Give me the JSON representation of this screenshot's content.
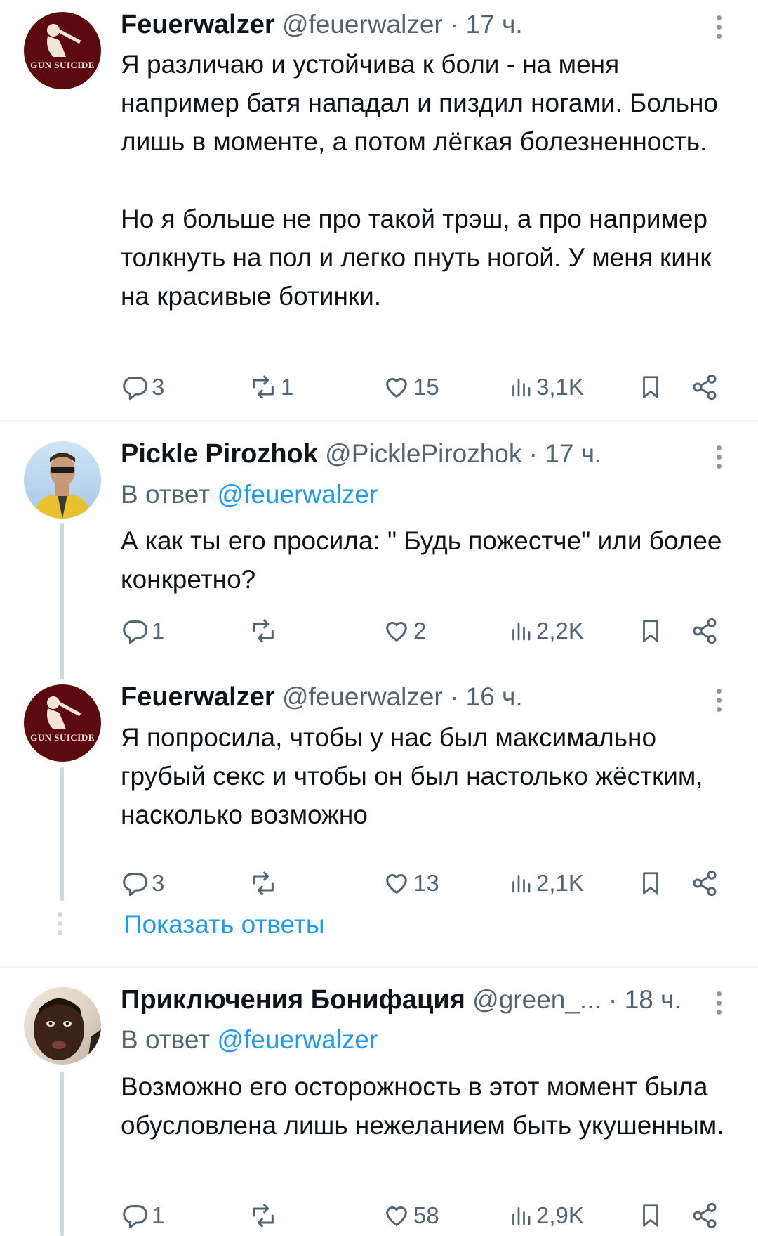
{
  "tweets": [
    {
      "name": "Feuerwalzer",
      "handle": "@feuerwalzer",
      "dot": "·",
      "time": "17 ч.",
      "avatar_icon": "gun-suicide-avatar",
      "avatar_text": "GUN SUICIDE",
      "body": "Я различаю и устойчива к боли  - на меня например батя нападал и пиздил ногами. Больно лишь в моменте, а потом лёгкая болезненность.\n\nНо я больше не про такой трэш, а про например толкнуть на пол и легко пнуть ногой. У меня кинк на красивые ботинки.",
      "replies": "3",
      "retweets": "1",
      "likes": "15",
      "views": "3,1K"
    },
    {
      "name": "Pickle Pirozhok",
      "handle": "@PicklePirozhok",
      "dot": "·",
      "time": "17 ч.",
      "reply_prefix": "В ответ",
      "reply_to": "@feuerwalzer",
      "body": "А как ты его просила: \"  Будь пожестче\" или более конкретно?",
      "replies": "1",
      "retweets": "",
      "likes": "2",
      "views": "2,2K"
    },
    {
      "name": "Feuerwalzer",
      "handle": "@feuerwalzer",
      "dot": "·",
      "time": "16 ч.",
      "avatar_text": "GUN SUICIDE",
      "body": "Я попросила, чтобы у нас был максимально грубый секс и чтобы он был настолько жёстким, насколько возможно",
      "replies": "3",
      "retweets": "",
      "likes": "13",
      "views": "2,1K"
    },
    {
      "name": "Приключения Бонифация",
      "handle": "@green_...",
      "dot": "·",
      "time": "18 ч.",
      "reply_prefix": "В ответ",
      "reply_to": "@feuerwalzer",
      "body": "Возможно его осторожность в этот момент была обусловлена лишь нежеланием быть укушенным.",
      "replies": "1",
      "retweets": "",
      "likes": "58",
      "views": "2,9K"
    }
  ],
  "show_replies": "Показать ответы",
  "colors": {
    "text": "#0f1419",
    "muted": "#536471",
    "link": "#1d9bf0",
    "divider": "#eff3f4",
    "thread": "#cfd9de"
  }
}
